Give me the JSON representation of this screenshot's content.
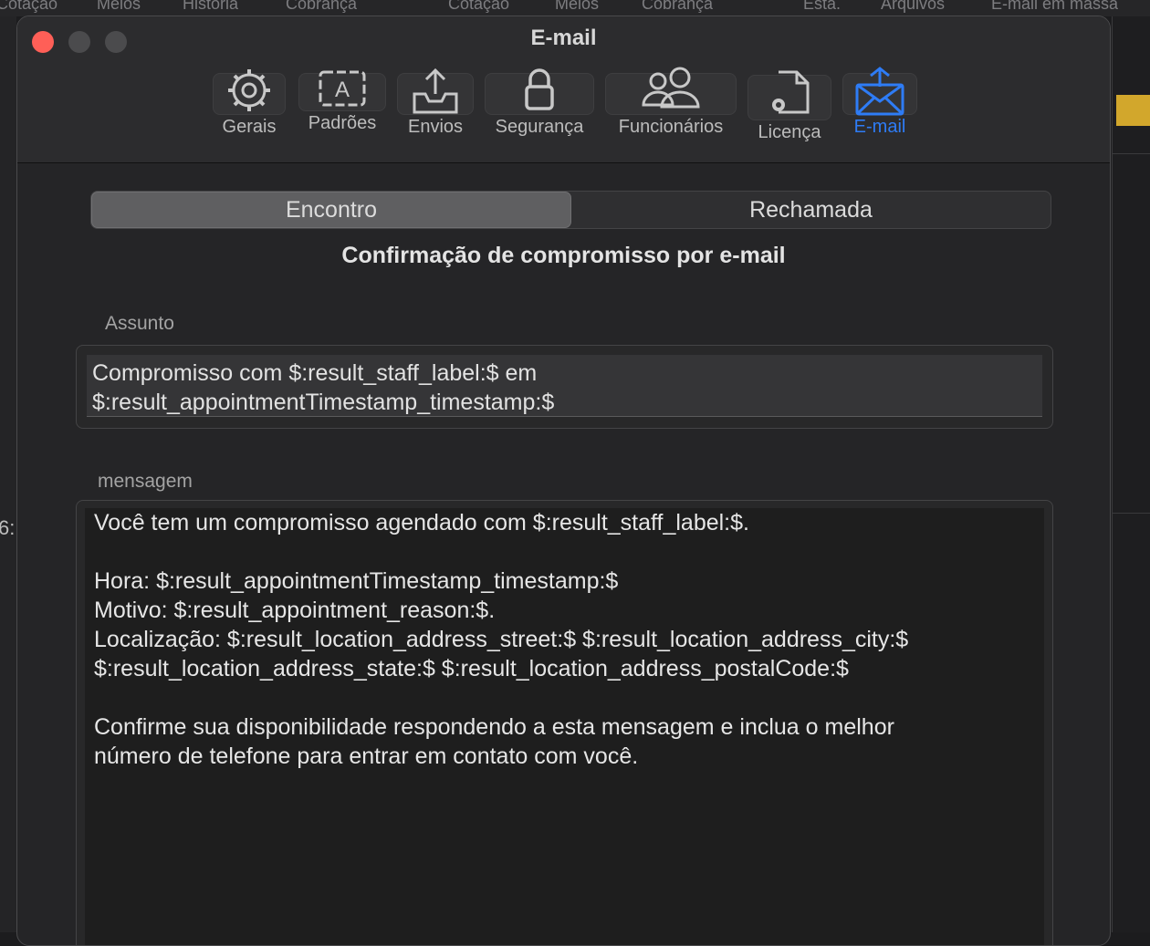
{
  "background_app": {
    "tabs": [
      "Cotação",
      "Meios",
      "História",
      "Cobrança",
      "Cotação",
      "Meios",
      "Cobrança",
      "Esta.",
      "Arquivos",
      "E-mail em massa"
    ],
    "side_number": "6:"
  },
  "window": {
    "title": "E-mail"
  },
  "toolbar": {
    "items": [
      {
        "label": "Gerais",
        "icon": "gear-icon"
      },
      {
        "label": "Padrões",
        "icon": "template-icon"
      },
      {
        "label": "Envios",
        "icon": "tray-upload-icon"
      },
      {
        "label": "Segurança",
        "icon": "lock-icon"
      },
      {
        "label": "Funcionários",
        "icon": "people-icon"
      },
      {
        "label": "Licença",
        "icon": "document-gear-icon"
      },
      {
        "label": "E-mail",
        "icon": "envelope-icon"
      }
    ],
    "active_color": "#2e7cf6"
  },
  "segmented": {
    "left": "Encontro",
    "right": "Rechamada"
  },
  "section_title": "Confirmação de compromisso por e-mail",
  "subject": {
    "label": "Assunto",
    "value": "Compromisso com $:result_staff_label:$ em\n$:result_appointmentTimestamp_timestamp:$"
  },
  "message": {
    "label": "mensagem",
    "value": "Você tem um compromisso agendado com $:result_staff_label:$.\n\nHora: $:result_appointmentTimestamp_timestamp:$\nMotivo: $:result_appointment_reason:$.\nLocalização: $:result_location_address_street:$ $:result_location_address_city:$\n$:result_location_address_state:$ $:result_location_address_postalCode:$\n\nConfirme sua disponibilidade respondendo a esta mensagem e inclua o melhor\nnúmero de telefone para entrar em contato com você."
  }
}
